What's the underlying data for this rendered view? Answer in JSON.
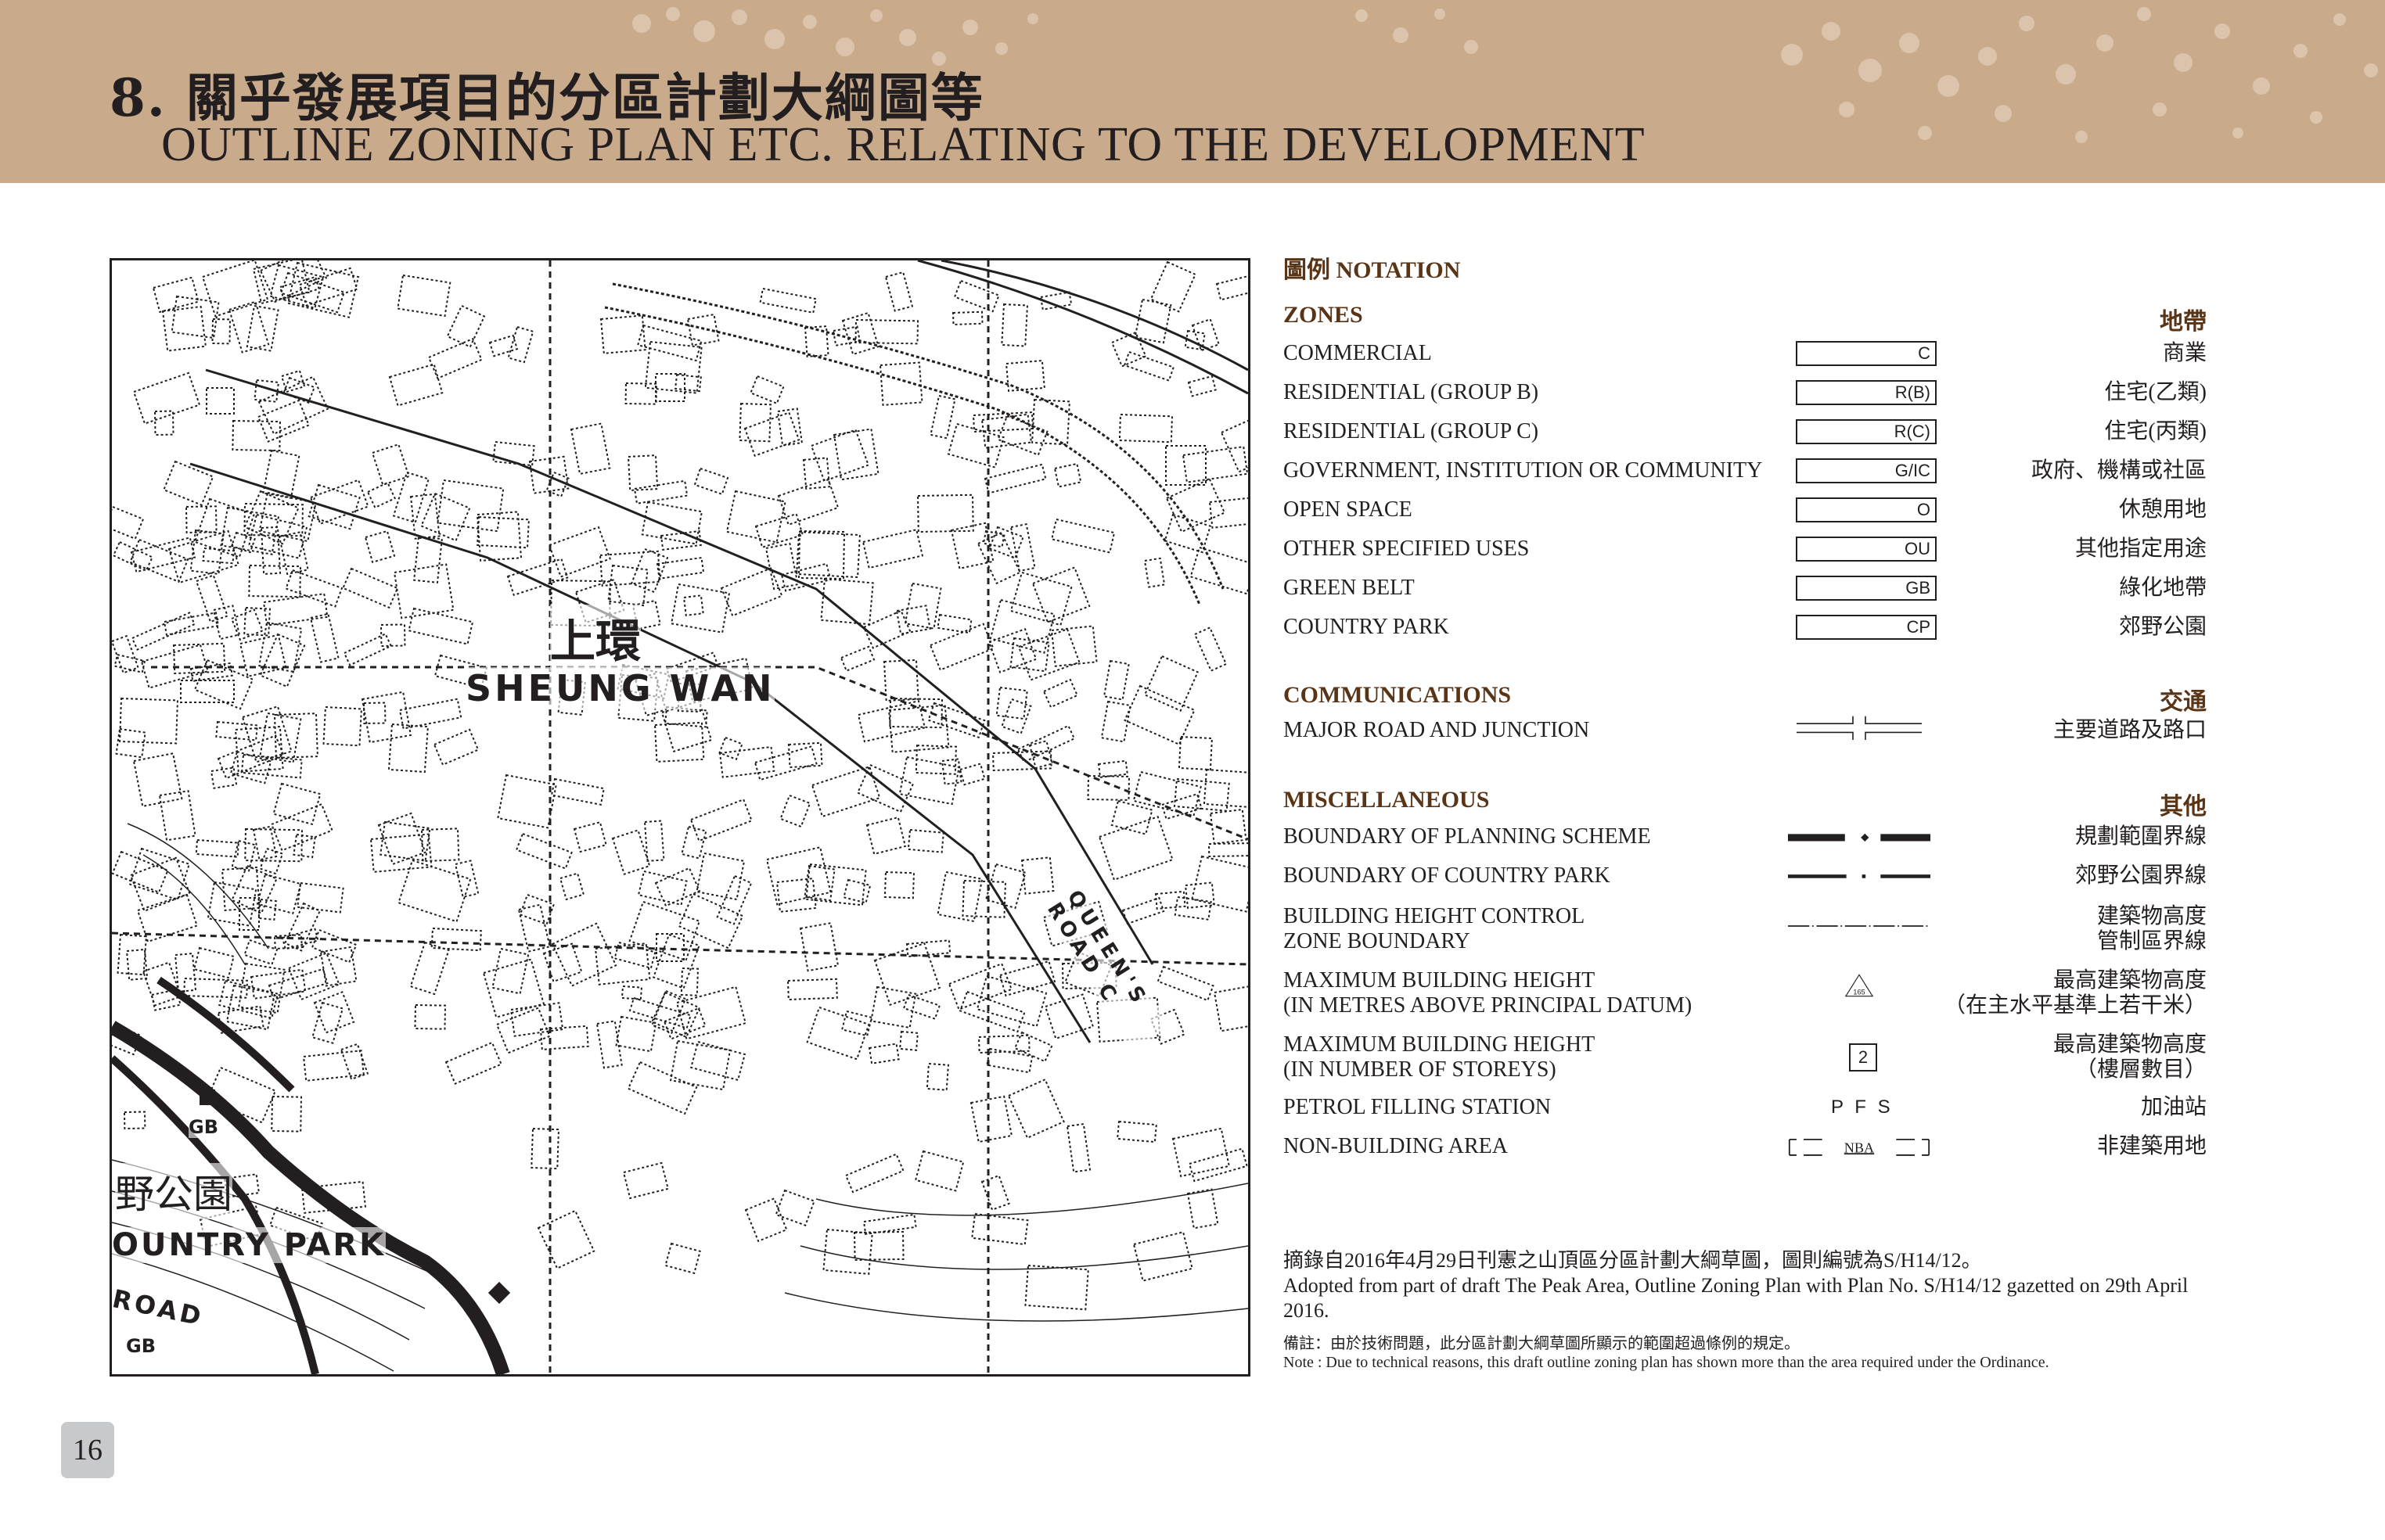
{
  "header": {
    "title_zh": "8. 關乎發展項目的分區計劃大綱圖等",
    "title_en": "OUTLINE ZONING PLAN ETC. RELATING TO THE DEVELOPMENT"
  },
  "map": {
    "labels": {
      "district_zh": "上環",
      "district_en": "SHEUNG WAN",
      "park_zh": "野公園",
      "park_en": "OUNTRY PARK",
      "road_fragment": "ROAD",
      "gb_1": "GB",
      "gb_2": "GB",
      "queens_road": "QUEEN'S ROAD C"
    }
  },
  "legend": {
    "title": "圖例 NOTATION",
    "zones": {
      "heading_en": "ZONES",
      "heading_zh": "地帶",
      "items": [
        {
          "en": "COMMERCIAL",
          "code": "C",
          "zh": "商業"
        },
        {
          "en": "RESIDENTIAL (GROUP B)",
          "code": "R(B)",
          "zh": "住宅(乙類)"
        },
        {
          "en": "RESIDENTIAL (GROUP C)",
          "code": "R(C)",
          "zh": "住宅(丙類)"
        },
        {
          "en": "GOVERNMENT, INSTITUTION OR COMMUNITY",
          "code": "G/IC",
          "zh": "政府、機構或社區"
        },
        {
          "en": "OPEN SPACE",
          "code": "O",
          "zh": "休憩用地"
        },
        {
          "en": "OTHER SPECIFIED USES",
          "code": "OU",
          "zh": "其他指定用途"
        },
        {
          "en": "GREEN BELT",
          "code": "GB",
          "zh": "綠化地帶"
        },
        {
          "en": "COUNTRY PARK",
          "code": "CP",
          "zh": "郊野公園"
        }
      ]
    },
    "communications": {
      "heading_en": "COMMUNICATIONS",
      "heading_zh": "交通",
      "items": [
        {
          "en": "MAJOR ROAD AND JUNCTION",
          "zh": "主要道路及路口"
        }
      ]
    },
    "misc": {
      "heading_en": "MISCELLANEOUS",
      "heading_zh": "其他",
      "items": [
        {
          "en": "BOUNDARY OF PLANNING SCHEME",
          "zh": "規劃範圍界線"
        },
        {
          "en": "BOUNDARY OF COUNTRY PARK",
          "zh": "郊野公園界線"
        },
        {
          "en1": "BUILDING HEIGHT CONTROL",
          "en2": "ZONE BOUNDARY",
          "zh1": "建築物高度",
          "zh2": "管制區界線"
        },
        {
          "en1": "MAXIMUM BUILDING HEIGHT",
          "en2": "(IN METRES ABOVE PRINCIPAL DATUM)",
          "zh1": "最高建築物高度",
          "zh2": "（在主水平基準上若干米）",
          "symbol_text": "165"
        },
        {
          "en1": "MAXIMUM BUILDING HEIGHT",
          "en2": "(IN NUMBER OF STOREYS)",
          "zh1": "最高建築物高度",
          "zh2": "（樓層數目）",
          "symbol_text": "2"
        },
        {
          "en": "PETROL FILLING STATION",
          "zh": "加油站",
          "symbol_text": "P F S"
        },
        {
          "en": "NON-BUILDING AREA",
          "zh": "非建築用地",
          "symbol_text": "NBA"
        }
      ]
    }
  },
  "notes": {
    "source_zh": "摘錄自2016年4月29日刊憲之山頂區分區計劃大綱草圖，圖則編號為S/H14/12。",
    "source_en": "Adopted from part of draft The Peak Area, Outline Zoning Plan with Plan No. S/H14/12 gazetted on 29th April 2016.",
    "remark_zh": "備註：由於技術問題，此分區計劃大綱草圖所顯示的範圍超過條例的規定。",
    "remark_en": "Note : Due to technical reasons, this draft outline zoning plan has shown more than the area required under the Ordinance."
  },
  "page_number": "16",
  "colors": {
    "header_band": "#c9ab8c",
    "heading_brown": "#5a3416",
    "page_tab": "#c8c9ca"
  }
}
